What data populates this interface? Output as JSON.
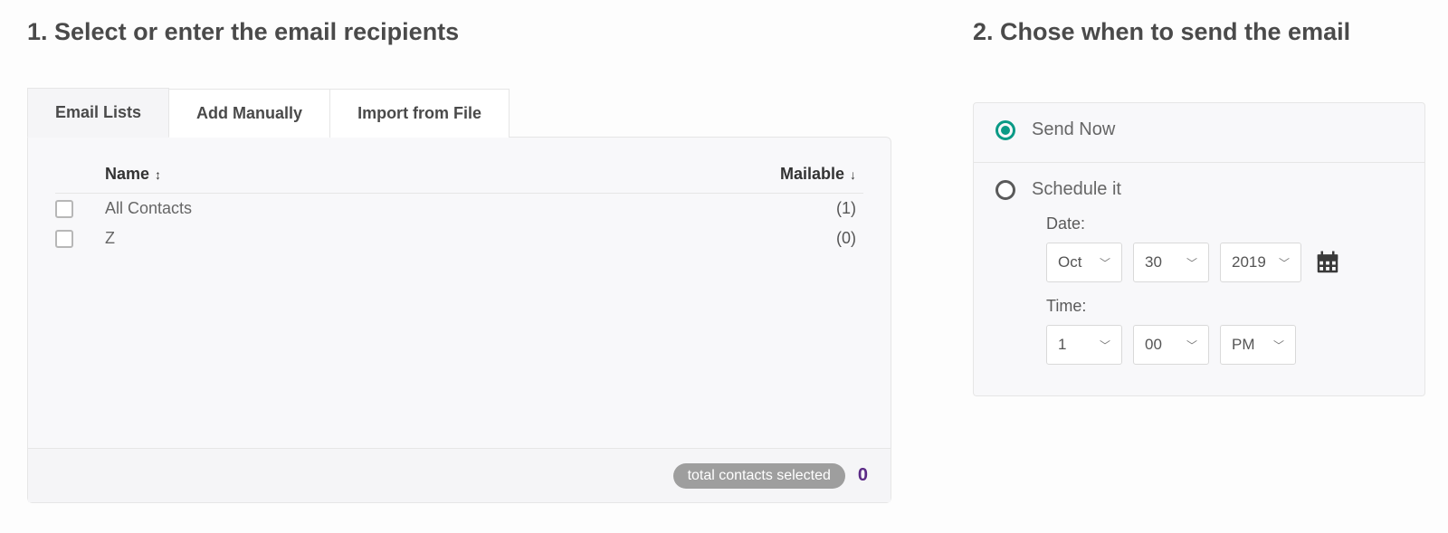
{
  "step1": {
    "title": "1.  Select or enter the email recipients",
    "tabs": [
      {
        "label": "Email Lists",
        "active": true
      },
      {
        "label": "Add Manually",
        "active": false
      },
      {
        "label": "Import from File",
        "active": false
      }
    ],
    "columns": {
      "name": "Name",
      "mailable": "Mailable"
    },
    "rows": [
      {
        "name": "All Contacts",
        "mailable": "(1)"
      },
      {
        "name": "Z",
        "mailable": "(0)"
      }
    ],
    "footer": {
      "pill": "total contacts selected",
      "count": "0"
    }
  },
  "step2": {
    "title": "2.  Chose when to send the email",
    "send_now_label": "Send Now",
    "schedule_label": "Schedule it",
    "date_label": "Date:",
    "time_label": "Time:",
    "date": {
      "month": "Oct",
      "day": "30",
      "year": "2019"
    },
    "time": {
      "hour": "1",
      "minute": "00",
      "ampm": "PM"
    }
  }
}
